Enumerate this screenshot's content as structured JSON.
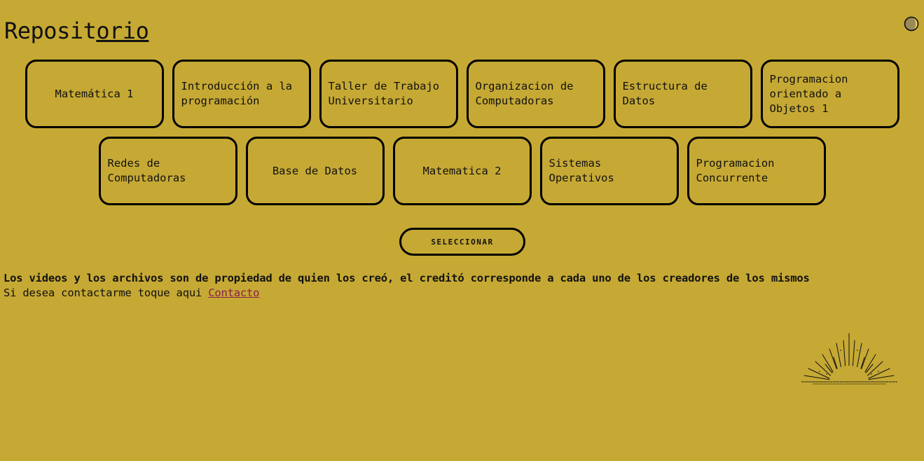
{
  "header": {
    "title_part1": "Reposit",
    "title_part2": "orio",
    "title_part3": "",
    "theme_icon": "moon-icon"
  },
  "subjects": {
    "row1": [
      "Matemática 1",
      "Introducción a la programación",
      "Taller de Trabajo Universitario",
      "Organizacion de Computadoras",
      "Estructura de Datos",
      "Programacion orientado a Objetos 1"
    ],
    "row2": [
      "Redes de Computadoras",
      "Base de Datos",
      "Matematica 2",
      "Sistemas Operativos",
      "Programacion Concurrente"
    ]
  },
  "actions": {
    "select_label": "SELECCIONAR"
  },
  "footer": {
    "disclaimer": "Los videos y los archivos son de propiedad de quien los creó, el creditó corresponde a cada uno de los creadores de los mismos",
    "contact_prefix": "Si desea contactarme toque aqui ",
    "contact_link": "Contacto"
  },
  "colors": {
    "background": "#c6a934",
    "link": "#8a1f4a",
    "border": "#000000"
  },
  "illustration": "sunrise-icon"
}
